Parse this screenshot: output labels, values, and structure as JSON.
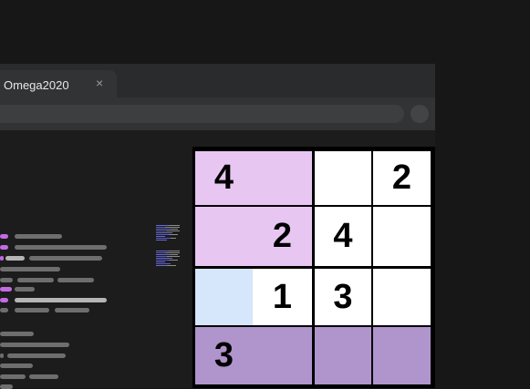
{
  "browser": {
    "tab_title": "Omega2020",
    "close_glyph": "×"
  },
  "colors": {
    "background": "#171717",
    "accent_purple": "#c36ae6",
    "block_highlight": "#e8c6f2",
    "row_highlight": "#b094cc",
    "selected_cell": "#d6e6fb",
    "cell_default": "#ffffff"
  },
  "sudoku": {
    "size": 4,
    "cells": [
      {
        "row": 0,
        "col": 0,
        "value": "4",
        "state": "block"
      },
      {
        "row": 0,
        "col": 1,
        "value": "",
        "state": "block"
      },
      {
        "row": 0,
        "col": 2,
        "value": "",
        "state": "normal"
      },
      {
        "row": 0,
        "col": 3,
        "value": "2",
        "state": "normal"
      },
      {
        "row": 1,
        "col": 0,
        "value": "",
        "state": "block"
      },
      {
        "row": 1,
        "col": 1,
        "value": "2",
        "state": "block"
      },
      {
        "row": 1,
        "col": 2,
        "value": "4",
        "state": "normal"
      },
      {
        "row": 1,
        "col": 3,
        "value": "",
        "state": "normal"
      },
      {
        "row": 2,
        "col": 0,
        "value": "",
        "state": "selected"
      },
      {
        "row": 2,
        "col": 1,
        "value": "1",
        "state": "normal"
      },
      {
        "row": 2,
        "col": 2,
        "value": "3",
        "state": "normal"
      },
      {
        "row": 2,
        "col": 3,
        "value": "",
        "state": "normal"
      },
      {
        "row": 3,
        "col": 0,
        "value": "3",
        "state": "row"
      },
      {
        "row": 3,
        "col": 1,
        "value": "",
        "state": "row"
      },
      {
        "row": 3,
        "col": 2,
        "value": "",
        "state": "row"
      },
      {
        "row": 3,
        "col": 3,
        "value": "",
        "state": "row"
      }
    ]
  }
}
